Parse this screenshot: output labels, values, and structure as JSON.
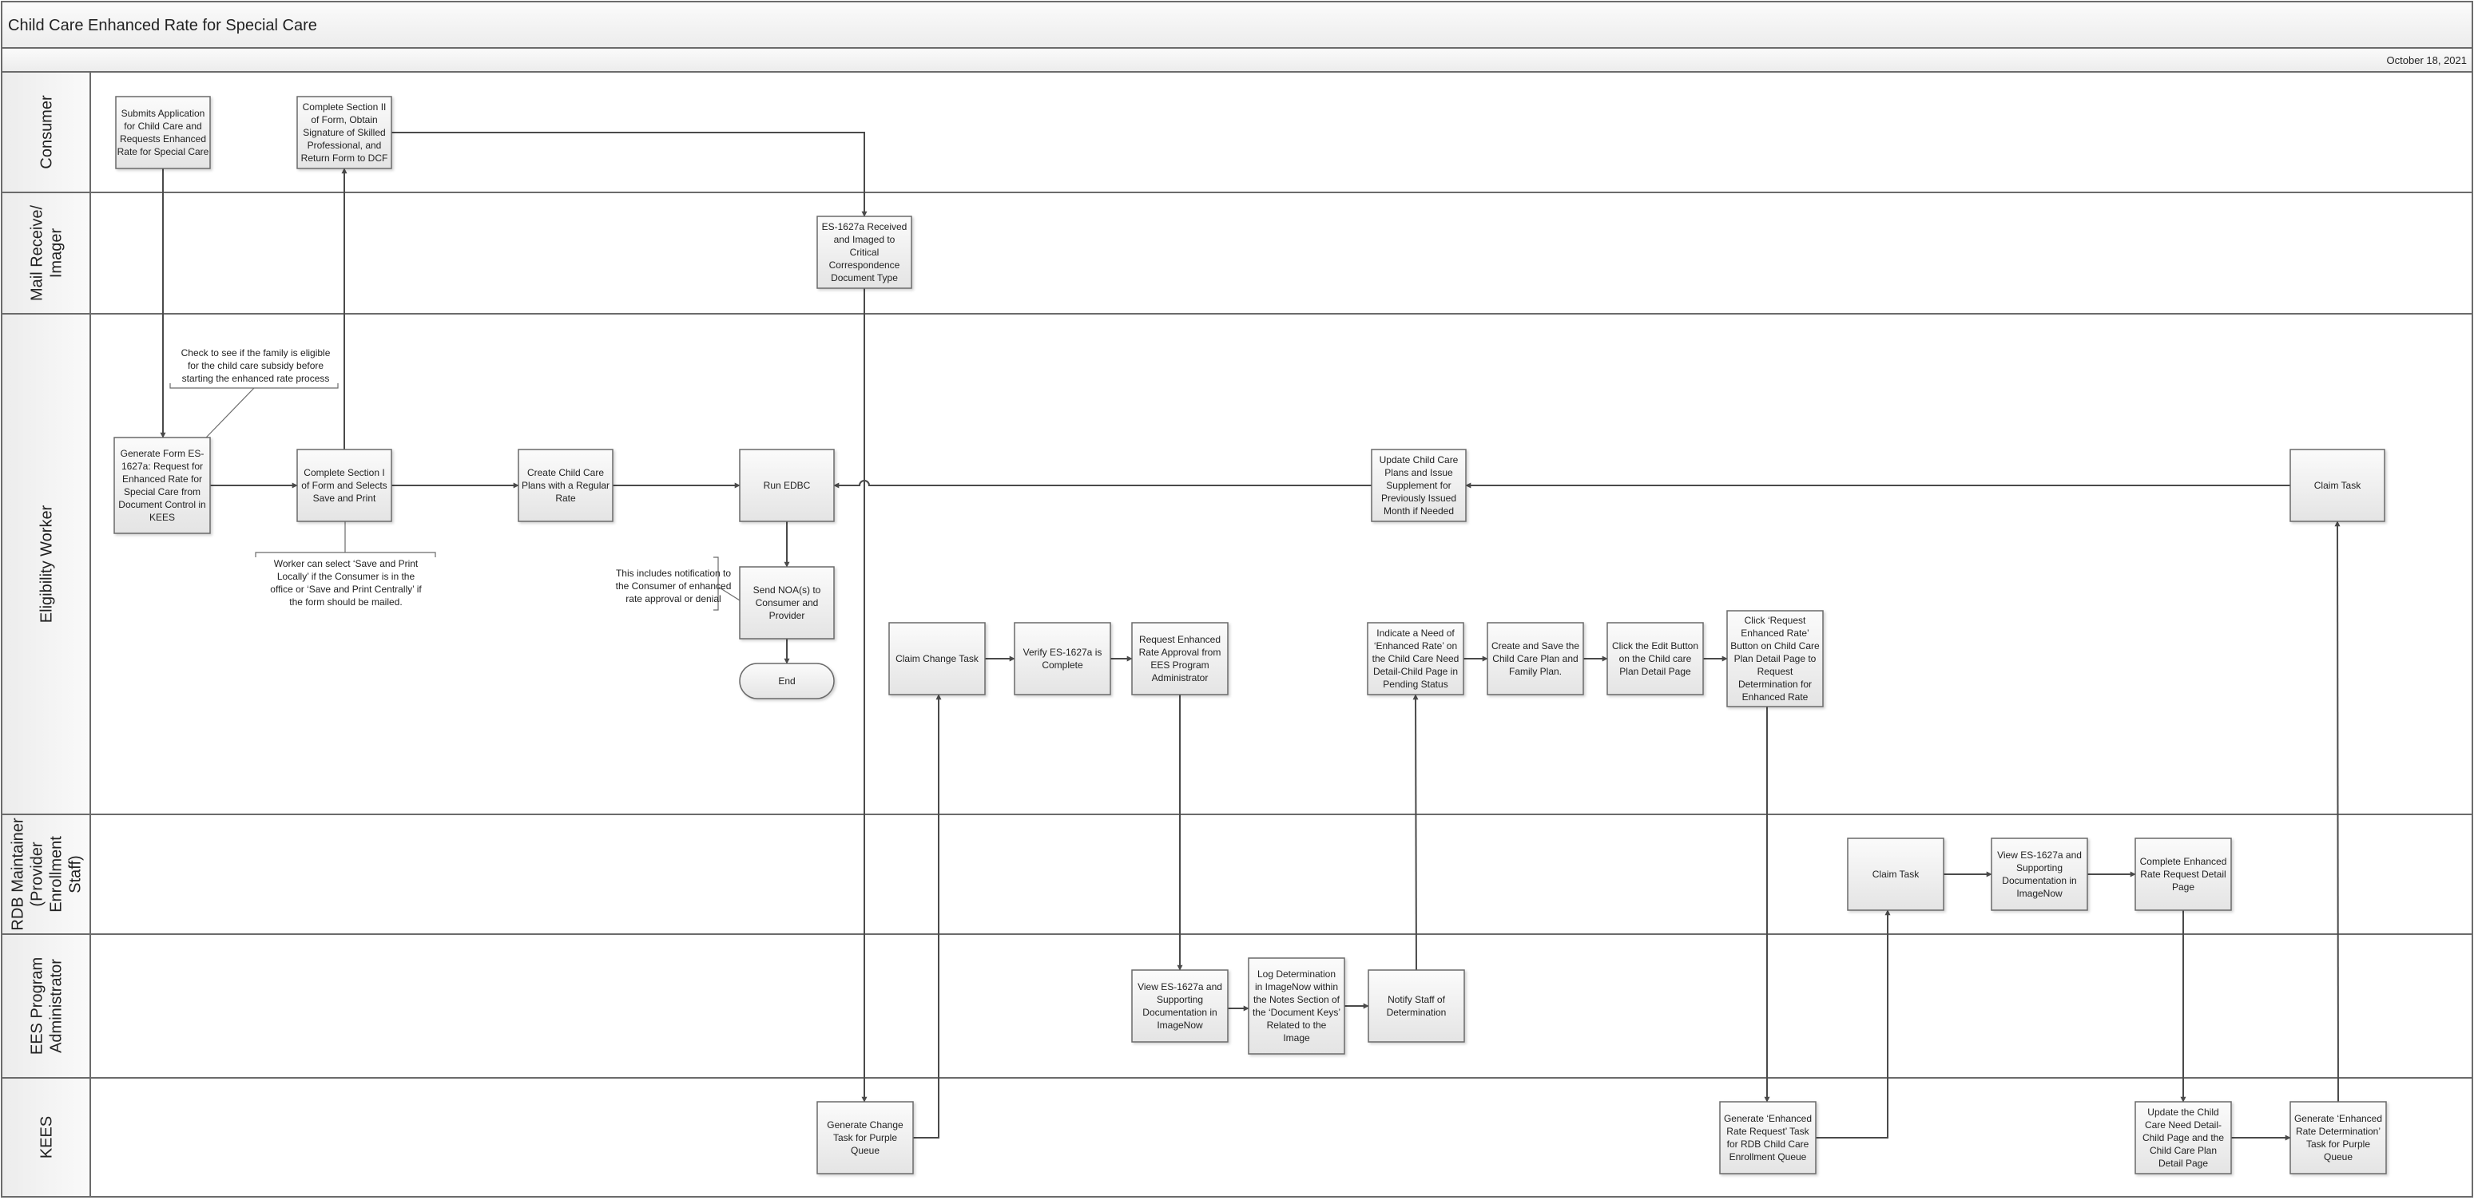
{
  "header": {
    "title": "Child Care Enhanced Rate for Special Care",
    "date": "October 18, 2021"
  },
  "lanes": [
    {
      "id": "consumer",
      "label": [
        "Consumer"
      ]
    },
    {
      "id": "mail",
      "label": [
        "Mail Receive/",
        "Imager"
      ]
    },
    {
      "id": "eligibility",
      "label": [
        "Eligibility Worker"
      ]
    },
    {
      "id": "rdb",
      "label": [
        "RDB Maintainer",
        "(Provider",
        "Enrollment",
        "Staff)"
      ]
    },
    {
      "id": "ees",
      "label": [
        "EES Program",
        "Administrator"
      ]
    },
    {
      "id": "kees",
      "label": [
        "KEES"
      ]
    }
  ],
  "steps": [
    {
      "id": "submit_app",
      "lane": "consumer",
      "lines": [
        "Submits Application",
        "for Child Care and",
        "Requests Enhanced",
        "Rate for Special Care"
      ]
    },
    {
      "id": "complete_sec2",
      "lane": "consumer",
      "lines": [
        "Complete Section II",
        "of Form, Obtain",
        "Signature of Skilled",
        "Professional, and",
        "Return Form to DCF"
      ]
    },
    {
      "id": "es_received",
      "lane": "mail",
      "lines": [
        "ES-1627a Received",
        "and Imaged to",
        "Critical",
        "Correspondence",
        "Document Type"
      ]
    },
    {
      "id": "generate_form",
      "lane": "eligibility",
      "lines": [
        "Generate Form ES-",
        "1627a:  Request for",
        "Enhanced Rate for",
        "Special Care from",
        "Document Control in",
        "KEES"
      ]
    },
    {
      "id": "complete_sec1",
      "lane": "eligibility",
      "lines": [
        "Complete Section I",
        "of Form and Selects",
        "Save and Print"
      ]
    },
    {
      "id": "create_plans",
      "lane": "eligibility",
      "lines": [
        "Create Child Care",
        "Plans with a Regular",
        "Rate"
      ]
    },
    {
      "id": "run_edbc",
      "lane": "eligibility",
      "lines": [
        "Run EDBC"
      ]
    },
    {
      "id": "update_plans",
      "lane": "eligibility",
      "lines": [
        "Update Child Care",
        "Plans and Issue",
        "Supplement for",
        "Previously Issued",
        "Month if Needed"
      ]
    },
    {
      "id": "claim_task_ew",
      "lane": "eligibility",
      "lines": [
        "Claim Task"
      ]
    },
    {
      "id": "send_noa",
      "lane": "eligibility",
      "lines": [
        "Send NOA(s) to",
        "Consumer and",
        "Provider"
      ]
    },
    {
      "id": "end",
      "lane": "eligibility",
      "type": "terminator",
      "lines": [
        "End"
      ]
    },
    {
      "id": "claim_change",
      "lane": "eligibility",
      "lines": [
        "Claim Change Task"
      ]
    },
    {
      "id": "verify",
      "lane": "eligibility",
      "lines": [
        "Verify ES-1627a is",
        "Complete"
      ]
    },
    {
      "id": "request_approval",
      "lane": "eligibility",
      "lines": [
        "Request Enhanced",
        "Rate Approval from",
        "EES Program",
        "Administrator"
      ]
    },
    {
      "id": "indicate_need",
      "lane": "eligibility",
      "lines": [
        "Indicate a Need of",
        "‘Enhanced Rate’ on",
        "the Child Care Need",
        "Detail-Child Page in",
        "Pending Status"
      ]
    },
    {
      "id": "create_save",
      "lane": "eligibility",
      "lines": [
        "Create and Save the",
        "Child Care Plan and",
        "Family Plan."
      ]
    },
    {
      "id": "click_edit",
      "lane": "eligibility",
      "lines": [
        "Click the Edit Button",
        "on the Child care",
        "Plan Detail Page"
      ]
    },
    {
      "id": "click_request",
      "lane": "eligibility",
      "lines": [
        "Click ‘Request",
        "Enhanced Rate’",
        "Button on Child Care",
        "Plan Detail Page to",
        "Request",
        "Determination for",
        "Enhanced Rate"
      ]
    },
    {
      "id": "claim_task_rdb",
      "lane": "rdb",
      "lines": [
        "Claim Task"
      ]
    },
    {
      "id": "view_es_rdb",
      "lane": "rdb",
      "lines": [
        "View ES-1627a and",
        "Supporting",
        "Documentation in",
        "ImageNow"
      ]
    },
    {
      "id": "complete_enhanced",
      "lane": "rdb",
      "lines": [
        "Complete Enhanced",
        "Rate Request Detail",
        "Page"
      ]
    },
    {
      "id": "view_es_ees",
      "lane": "ees",
      "lines": [
        "View ES-1627a and",
        "Supporting",
        "Documentation in",
        "ImageNow"
      ]
    },
    {
      "id": "log_determination",
      "lane": "ees",
      "lines": [
        "Log Determination",
        "in ImageNow within",
        "the Notes Section of",
        "the ‘Document Keys’",
        "Related to the",
        "Image"
      ]
    },
    {
      "id": "notify_staff",
      "lane": "ees",
      "lines": [
        "Notify Staff of",
        "Determination"
      ]
    },
    {
      "id": "gen_change_task",
      "lane": "kees",
      "lines": [
        "Generate Change",
        "Task for Purple",
        "Queue"
      ]
    },
    {
      "id": "gen_request_task",
      "lane": "kees",
      "lines": [
        "Generate ‘Enhanced",
        "Rate Request’ Task",
        "for RDB Child Care",
        "Enrollment Queue"
      ]
    },
    {
      "id": "update_need_detail",
      "lane": "kees",
      "lines": [
        "Update the Child",
        "Care Need Detail-",
        "Child Page and the",
        "Child Care Plan",
        "Detail Page"
      ]
    },
    {
      "id": "gen_determination_task",
      "lane": "kees",
      "lines": [
        "Generate ‘Enhanced",
        "Rate Determination’",
        "Task for Purple",
        "Queue"
      ]
    }
  ],
  "notes": [
    {
      "id": "eligibility_check",
      "lines": [
        "Check to see if the family is eligible",
        "for the child care subsidy before",
        "starting the enhanced rate process"
      ]
    },
    {
      "id": "save_print",
      "lines": [
        "Worker can select ‘Save and Print",
        "Locally’ if the Consumer is in the",
        "office or ‘Save and Print Centrally’ if",
        "the form should be mailed."
      ]
    },
    {
      "id": "noa_note",
      "lines": [
        "This includes notification to",
        "the Consumer of enhanced",
        "rate approval or denial"
      ]
    }
  ],
  "flows": [
    [
      "submit_app",
      "generate_form"
    ],
    [
      "generate_form",
      "complete_sec1"
    ],
    [
      "complete_sec1",
      "complete_sec2"
    ],
    [
      "complete_sec1",
      "create_plans"
    ],
    [
      "complete_sec2",
      "es_received"
    ],
    [
      "es_received",
      "gen_change_task"
    ],
    [
      "create_plans",
      "run_edbc"
    ],
    [
      "run_edbc",
      "send_noa"
    ],
    [
      "send_noa",
      "end"
    ],
    [
      "update_plans",
      "run_edbc"
    ],
    [
      "claim_task_ew",
      "update_plans"
    ],
    [
      "gen_change_task",
      "claim_change"
    ],
    [
      "claim_change",
      "verify"
    ],
    [
      "verify",
      "request_approval"
    ],
    [
      "request_approval",
      "view_es_ees"
    ],
    [
      "view_es_ees",
      "log_determination"
    ],
    [
      "log_determination",
      "notify_staff"
    ],
    [
      "notify_staff",
      "indicate_need"
    ],
    [
      "indicate_need",
      "create_save"
    ],
    [
      "create_save",
      "click_edit"
    ],
    [
      "click_edit",
      "click_request"
    ],
    [
      "click_request",
      "gen_request_task"
    ],
    [
      "gen_request_task",
      "claim_task_rdb"
    ],
    [
      "claim_task_rdb",
      "view_es_rdb"
    ],
    [
      "view_es_rdb",
      "complete_enhanced"
    ],
    [
      "complete_enhanced",
      "update_need_detail"
    ],
    [
      "update_need_detail",
      "gen_determination_task"
    ],
    [
      "gen_determination_task",
      "claim_task_ew"
    ]
  ],
  "colors": {
    "border": "#6b6b6b",
    "connector": "#4a4a4a",
    "box_fill_top": "#fafafa",
    "box_fill_bottom": "#e6e6e6",
    "header_fill": "#f2f2f2"
  }
}
